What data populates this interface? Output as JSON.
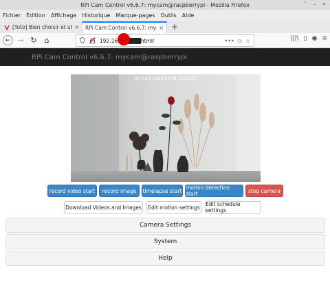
{
  "window": {
    "title": "RPi Cam Control v6.6.7: mycam@raspberrypi - Mozilla Firefox",
    "controls": [
      "˄",
      "–",
      "×"
    ]
  },
  "menubar": {
    "items": [
      "Fichier",
      "Édition",
      "Affichage",
      "Historique",
      "Marque-pages",
      "Outils",
      "Aide"
    ]
  },
  "tabs": [
    {
      "label": "[Tuto] Bien choisir et utilise",
      "close": "×",
      "favicon_color": "#c0392b"
    },
    {
      "label": "RPi Cam Control v6.6.7: mycam",
      "close": "×"
    }
  ],
  "new_tab": "+",
  "navbar": {
    "back": "←",
    "forward": "→",
    "reload": "↻",
    "home": "⌂",
    "url": "192.168.1.100/html/",
    "url_visible": "192.168█████html/",
    "more": "•••",
    "pocket": "◇",
    "star": "☆",
    "library": "|||\\",
    "sidebar": "▯",
    "account": "◉",
    "menu": "≡"
  },
  "site": {
    "title": "RPi Cam Control v6.6.7: mycam@raspberrypi"
  },
  "preview": {
    "caption": "RPi Cam  2020.02.08_10:53:57"
  },
  "buttons_row1": [
    {
      "label": "record video start",
      "style": "blue"
    },
    {
      "label": "record image",
      "style": "blue"
    },
    {
      "label": "timelapse start",
      "style": "blue"
    },
    {
      "label": "motion detection start",
      "style": "blue"
    },
    {
      "label": "stop camera",
      "style": "red"
    }
  ],
  "buttons_row2": [
    {
      "label": "Download Videos and Images"
    },
    {
      "label": "Edit motion settings"
    },
    {
      "label": "Edit schedule settings"
    }
  ],
  "sections": [
    "Camera Settings",
    "System",
    "Help"
  ],
  "colors": {
    "accent_blue": "#3a86c8",
    "stop_red": "#d9534f",
    "site_header": "#202020",
    "tab_highlight": "#0a84ff"
  }
}
